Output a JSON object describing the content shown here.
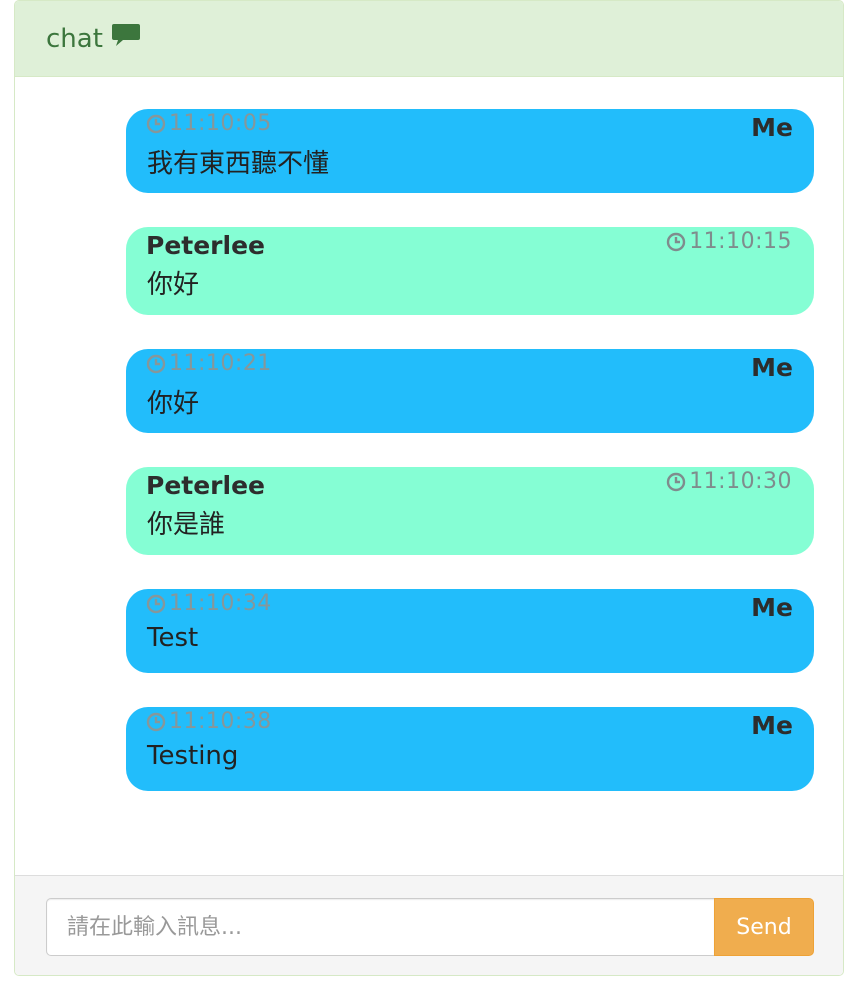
{
  "header": {
    "title": "chat",
    "icon": "comment-icon",
    "color": "#3c763d",
    "background": "#dff0d8"
  },
  "messages": [
    {
      "from": "me",
      "sender": "Me",
      "time": "11:10:05",
      "text": "我有東西聽不懂"
    },
    {
      "from": "peer",
      "sender": "Peterlee",
      "time": "11:10:15",
      "text": "你好"
    },
    {
      "from": "me",
      "sender": "Me",
      "time": "11:10:21",
      "text": "你好"
    },
    {
      "from": "peer",
      "sender": "Peterlee",
      "time": "11:10:30",
      "text": "你是誰"
    },
    {
      "from": "me",
      "sender": "Me",
      "time": "11:10:34",
      "text": "Test"
    },
    {
      "from": "me",
      "sender": "Me",
      "time": "11:10:38",
      "text": "Testing"
    }
  ],
  "colors": {
    "me_bubble": "#22bdfb",
    "peer_bubble": "#85fed4",
    "send_button": "#f0ad4e"
  },
  "composer": {
    "placeholder": "請在此輸入訊息...",
    "value": "",
    "send_label": "Send"
  }
}
